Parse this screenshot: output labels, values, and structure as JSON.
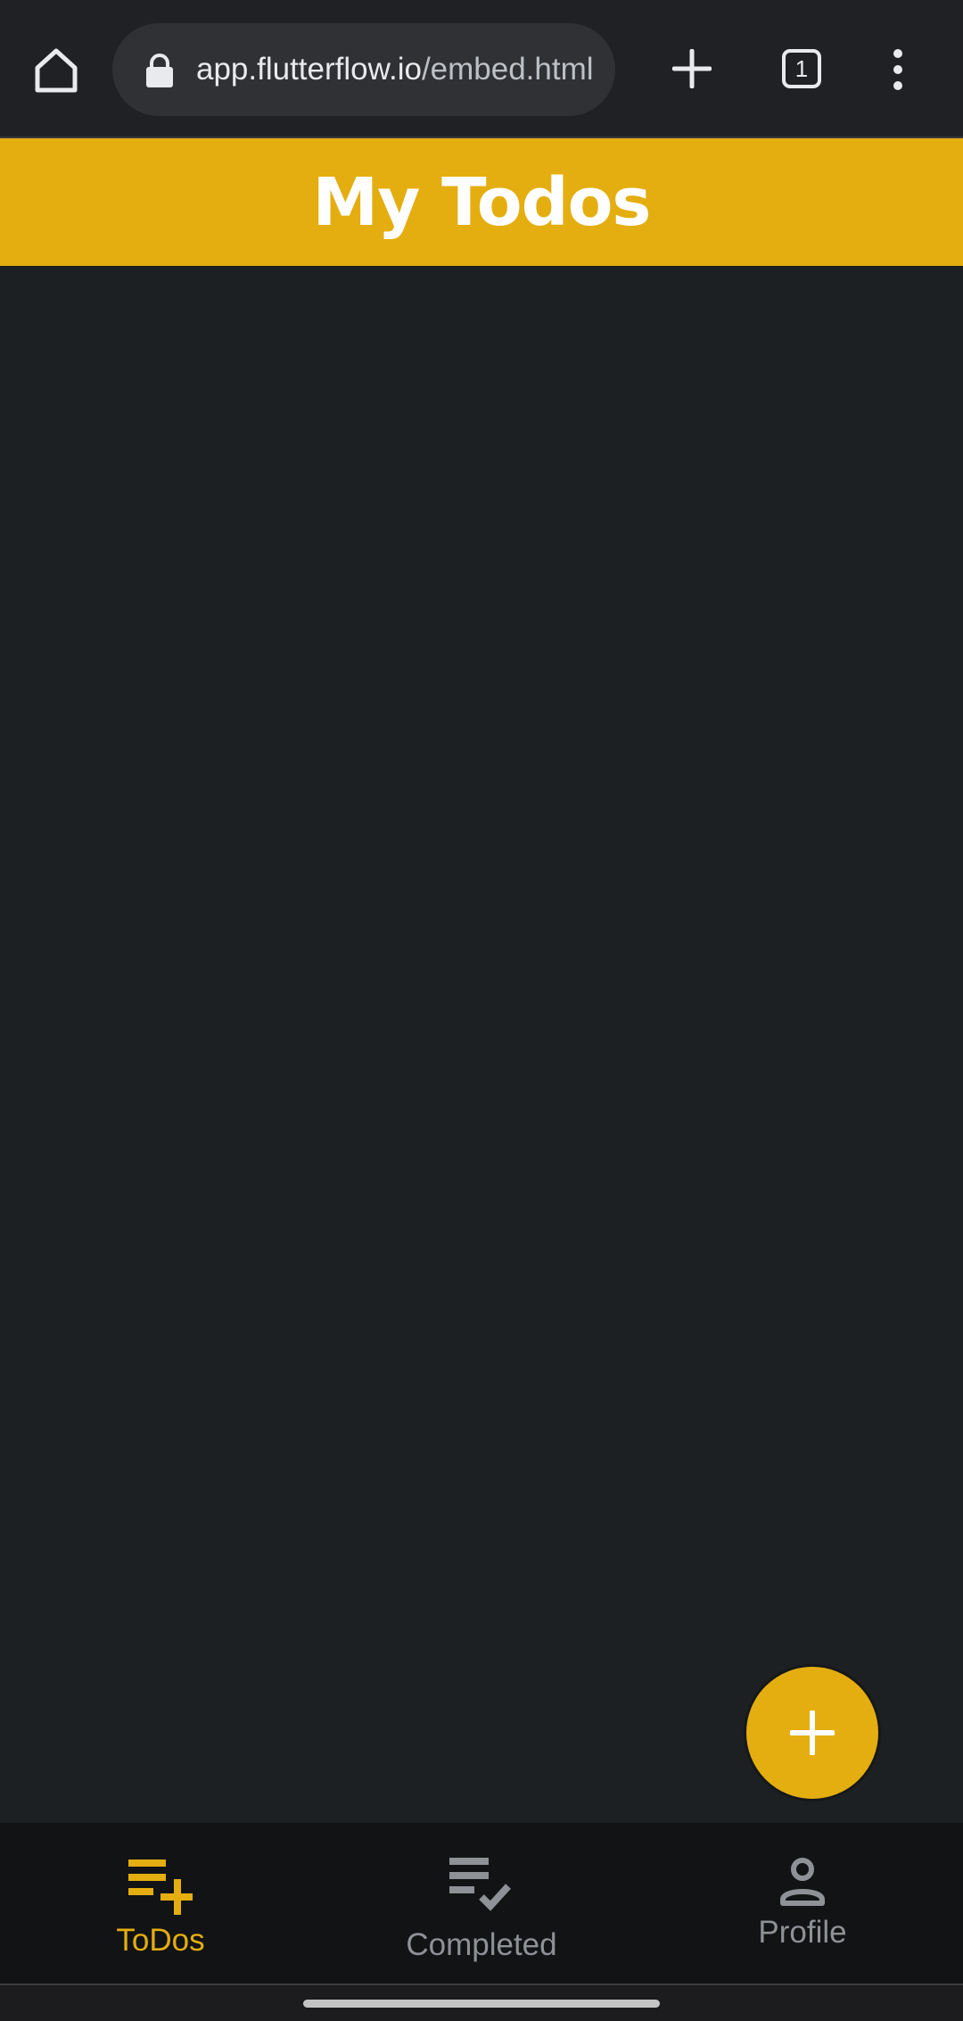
{
  "browser": {
    "url_domain": "app.flutterflow.io",
    "url_path": "/embed.html",
    "tab_count": "1"
  },
  "app": {
    "title": "My Todos"
  },
  "nav": {
    "items": [
      {
        "label": "ToDos",
        "icon": "playlist-add-icon",
        "active": true
      },
      {
        "label": "Completed",
        "icon": "playlist-add-check-icon",
        "active": false
      },
      {
        "label": "Profile",
        "icon": "person-outline-icon",
        "active": false
      }
    ]
  },
  "colors": {
    "accent": "#e4ae10",
    "background": "#1d2023",
    "nav_background": "#121315",
    "inactive": "#8e9196"
  }
}
